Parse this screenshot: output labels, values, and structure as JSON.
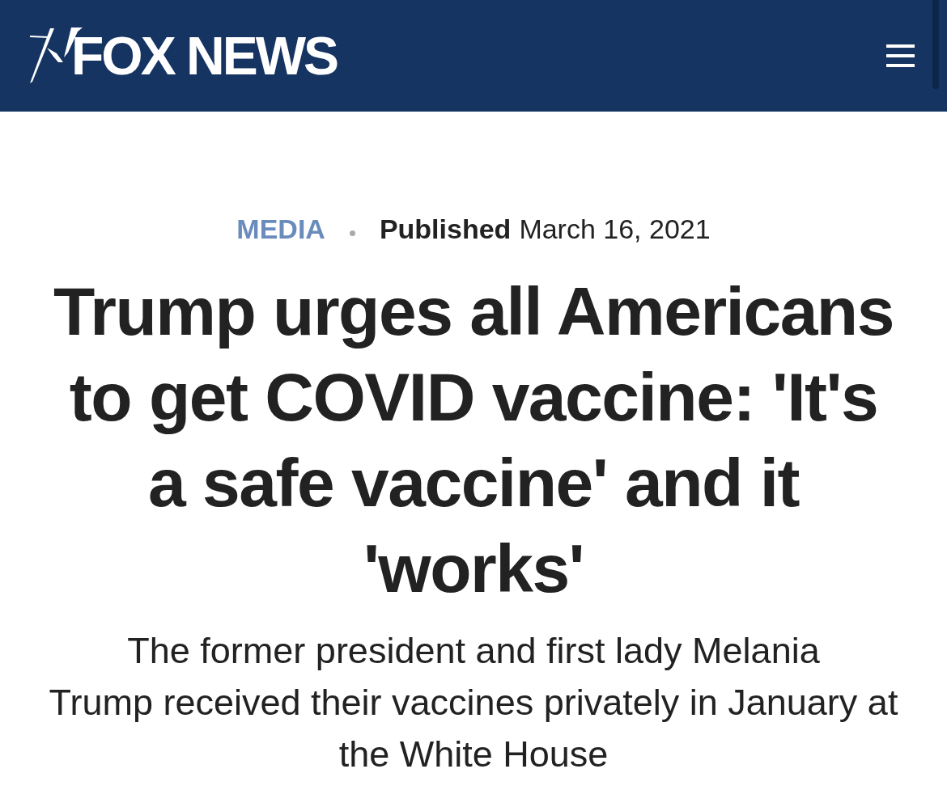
{
  "header": {
    "logo": "FOX NEWS"
  },
  "article": {
    "category": "MEDIA",
    "published_label": "Published",
    "date": "March 16, 2021",
    "headline": "Trump urges all Americans to get COVID vaccine: 'It's a safe vaccine' and it 'works'",
    "subheadline": "The former president and first lady Melania\nTrump received their vaccines privately in January at\nthe White House"
  }
}
